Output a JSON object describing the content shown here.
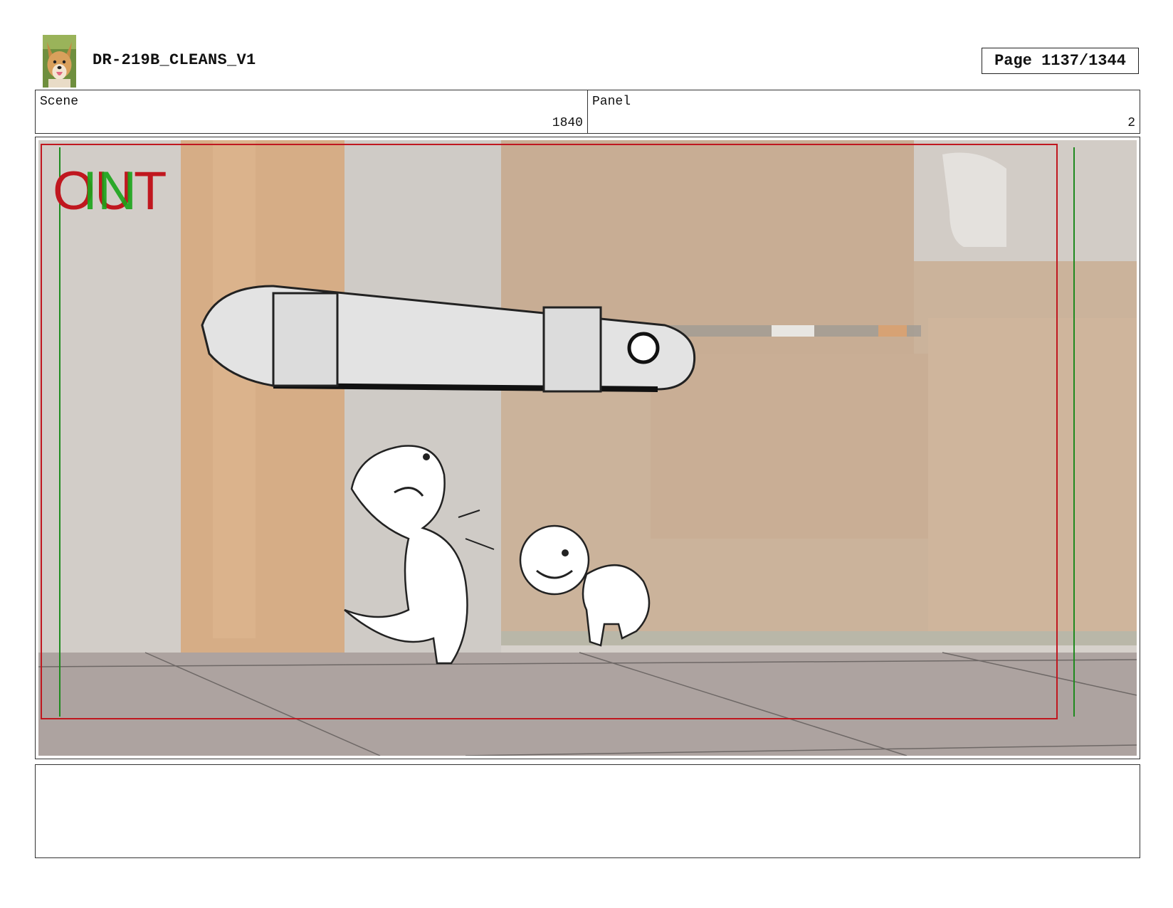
{
  "header": {
    "title": "DR-219B_CLEANS_V1",
    "page_label": "Page 1137/1344"
  },
  "info": {
    "scene_label": "Scene",
    "scene_value": "1840",
    "panel_label": "Panel",
    "panel_value": "2"
  },
  "frame": {
    "out_marker": "OUT",
    "in_marker": "IN",
    "out_color": "#c0171f",
    "in_color": "#1aa51a"
  },
  "notes": {
    "text": ""
  }
}
